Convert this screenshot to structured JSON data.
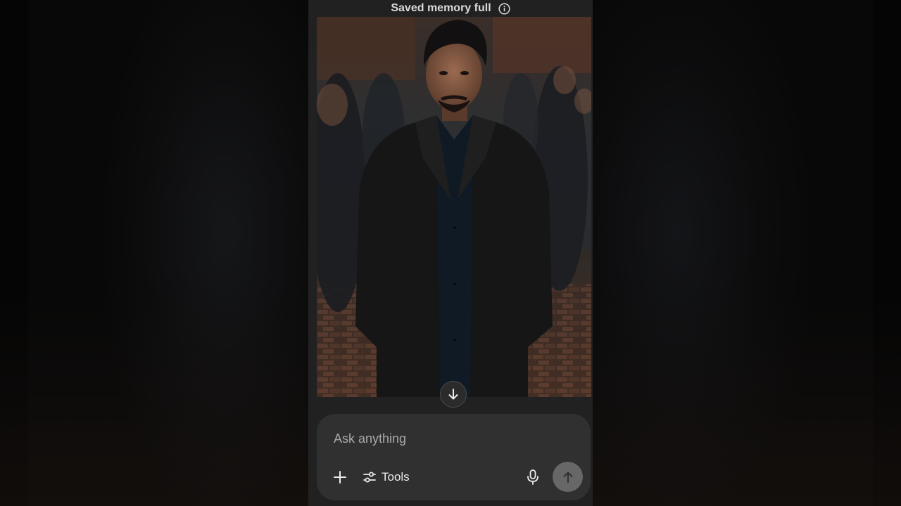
{
  "banner": {
    "text": "Saved memory full",
    "icon": "info-icon"
  },
  "image": {
    "description_icon": "portrait-photo"
  },
  "composer": {
    "placeholder": "Ask anything",
    "tools_label": "Tools",
    "icons": {
      "attach": "plus-icon",
      "tools": "sliders-icon",
      "mic": "microphone-icon",
      "send": "arrow-up-icon",
      "scroll": "arrow-down-icon"
    }
  },
  "colors": {
    "panel_bg": "#212121",
    "composer_bg": "#303030",
    "send_bg": "#676767",
    "text_primary": "#ececec",
    "placeholder": "#a8a8a8"
  }
}
